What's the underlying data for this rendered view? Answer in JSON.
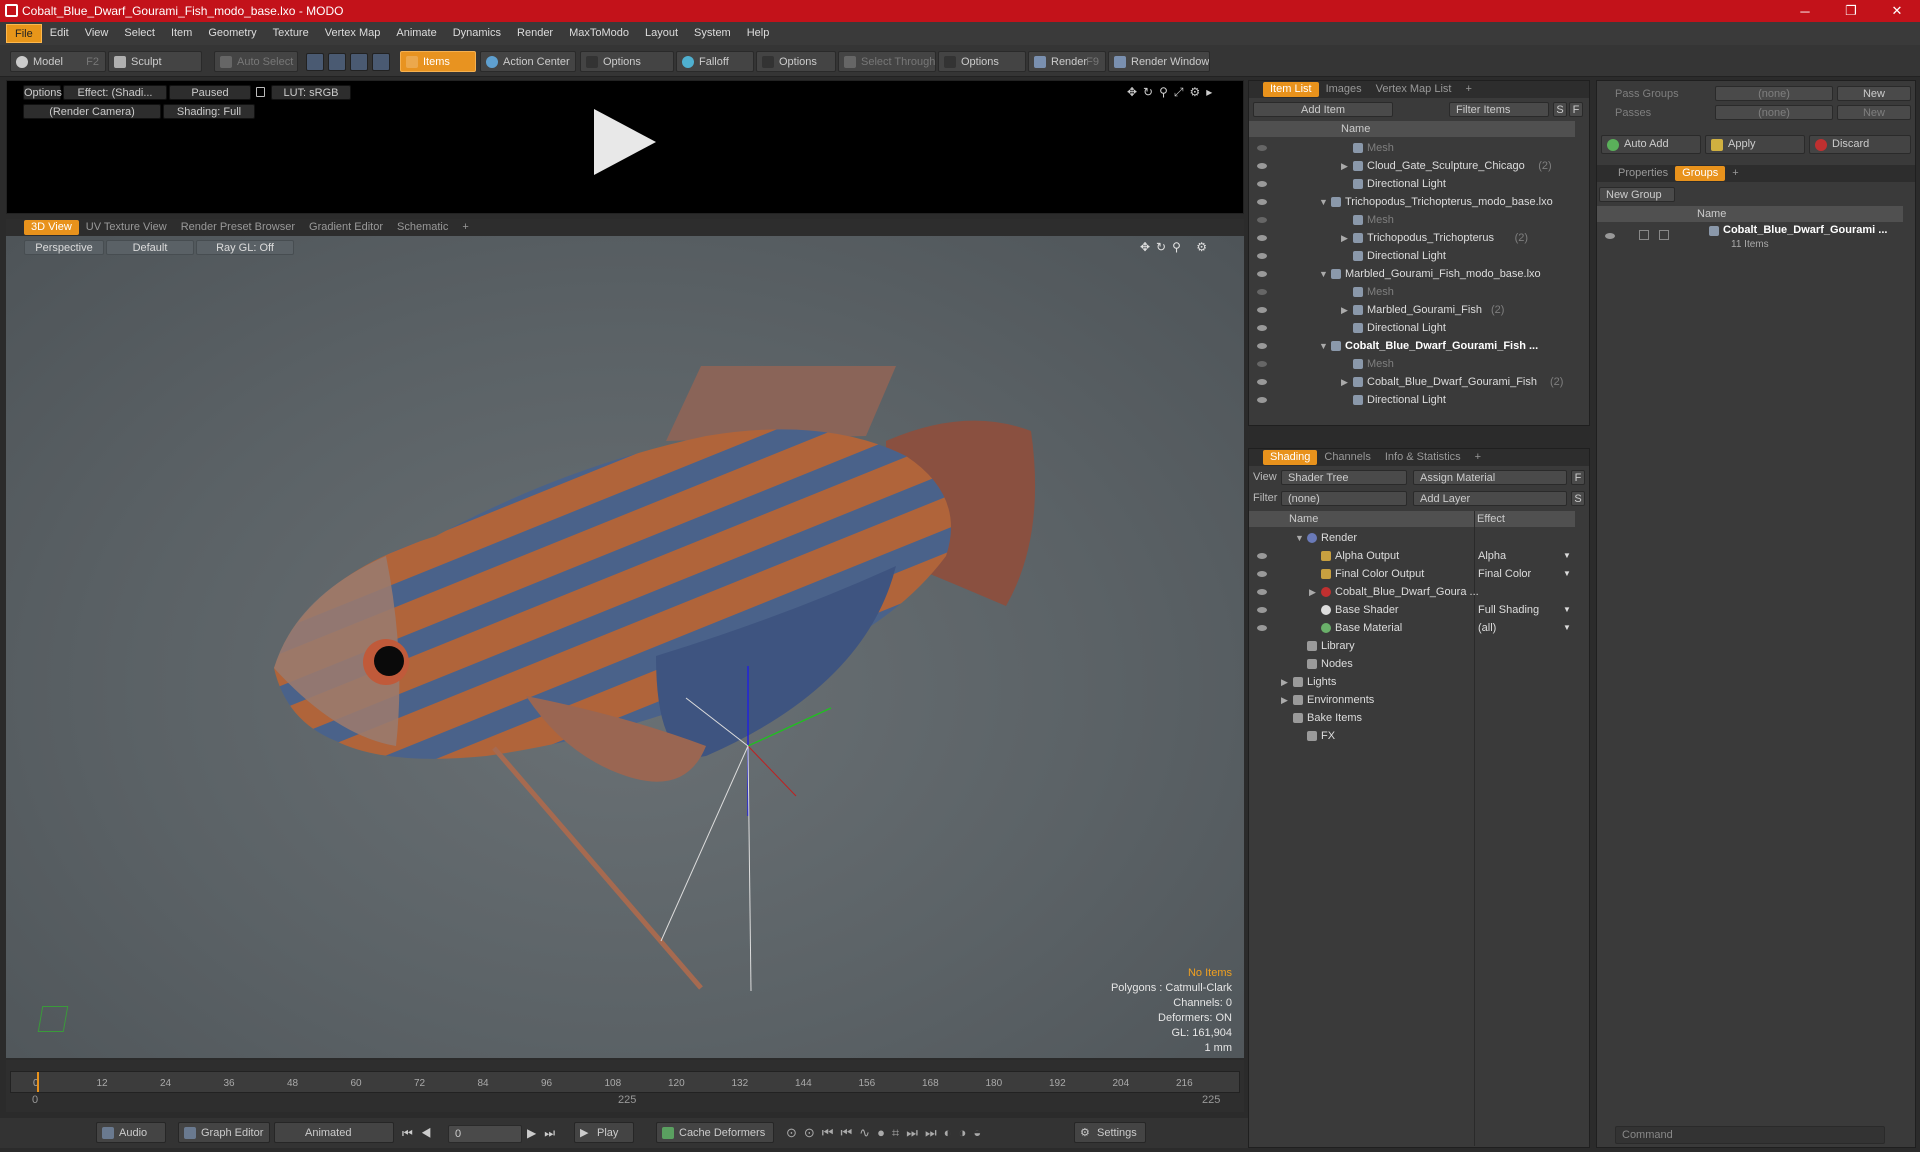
{
  "window": {
    "title": "Cobalt_Blue_Dwarf_Gourami_Fish_modo_base.lxo - MODO",
    "minimize": "─",
    "maximize": "❐",
    "close": "✕"
  },
  "menu": [
    "File",
    "Edit",
    "View",
    "Select",
    "Item",
    "Geometry",
    "Texture",
    "Vertex Map",
    "Animate",
    "Dynamics",
    "Render",
    "MaxToModo",
    "Layout",
    "System",
    "Help"
  ],
  "toolbar": {
    "model": "Model",
    "model_key": "F2",
    "sculpt": "Sculpt",
    "auto_select": "Auto Select",
    "items": "Items",
    "action_center": "Action Center",
    "options1": "Options",
    "falloff": "Falloff",
    "options2": "Options",
    "select_through": "Select Through",
    "options3": "Options",
    "render": "Render",
    "render_key": "F9",
    "render_window": "Render Window"
  },
  "preview": {
    "options": "Options",
    "effect": "Effect: (Shadi...",
    "paused": "Paused",
    "lut": "LUT: sRGB",
    "camera": "(Render Camera)",
    "shading": "Shading: Full"
  },
  "viewport_tabs": [
    "3D View",
    "UV Texture View",
    "Render Preset Browser",
    "Gradient Editor",
    "Schematic",
    "+"
  ],
  "viewport": {
    "perspective": "Perspective",
    "default": "Default",
    "raygl": "Ray GL: Off",
    "info": {
      "no_items": "No Items",
      "polygons": "Polygons : Catmull-Clark",
      "channels": "Channels: 0",
      "deformers": "Deformers: ON",
      "gl": "GL: 161,904",
      "unit": "1 mm"
    }
  },
  "timeline": {
    "ticks": [
      "0",
      "12",
      "24",
      "36",
      "48",
      "60",
      "72",
      "84",
      "96",
      "108",
      "120",
      "132",
      "144",
      "156",
      "168",
      "180",
      "192",
      "204",
      "216"
    ],
    "start": "0",
    "mid": "225",
    "end": "225"
  },
  "bottombar": {
    "audio": "Audio",
    "graph_editor": "Graph Editor",
    "animated": "Animated",
    "frame": "0",
    "play": "Play",
    "cache": "Cache Deformers",
    "settings": "Settings"
  },
  "item_list": {
    "tabs": [
      "Item List",
      "Images",
      "Vertex Map List",
      "+"
    ],
    "add_item": "Add Item",
    "filter_items": "Filter Items",
    "s": "S",
    "f": "F",
    "col_name": "Name",
    "rows": [
      {
        "label": "Mesh",
        "count": "",
        "indent": 2,
        "tri": "",
        "dim": true,
        "bold": false
      },
      {
        "label": "Cloud_Gate_Sculpture_Chicago",
        "count": "(2)",
        "indent": 2,
        "tri": "▶",
        "dim": false,
        "bold": false
      },
      {
        "label": "Directional Light",
        "count": "",
        "indent": 2,
        "tri": "",
        "dim": false,
        "bold": false
      },
      {
        "label": "Trichopodus_Trichopterus_modo_base.lxo",
        "count": "",
        "indent": 1,
        "tri": "▼",
        "dim": false,
        "bold": false
      },
      {
        "label": "Mesh",
        "count": "",
        "indent": 2,
        "tri": "",
        "dim": true,
        "bold": false
      },
      {
        "label": "Trichopodus_Trichopterus",
        "count": "(2)",
        "indent": 2,
        "tri": "▶",
        "dim": false,
        "bold": false
      },
      {
        "label": "Directional Light",
        "count": "",
        "indent": 2,
        "tri": "",
        "dim": false,
        "bold": false
      },
      {
        "label": "Marbled_Gourami_Fish_modo_base.lxo",
        "count": "",
        "indent": 1,
        "tri": "▼",
        "dim": false,
        "bold": false
      },
      {
        "label": "Mesh",
        "count": "",
        "indent": 2,
        "tri": "",
        "dim": true,
        "bold": false
      },
      {
        "label": "Marbled_Gourami_Fish",
        "count": "(2)",
        "indent": 2,
        "tri": "▶",
        "dim": false,
        "bold": false
      },
      {
        "label": "Directional Light",
        "count": "",
        "indent": 2,
        "tri": "",
        "dim": false,
        "bold": false
      },
      {
        "label": "Cobalt_Blue_Dwarf_Gourami_Fish ...",
        "count": "",
        "indent": 1,
        "tri": "▼",
        "dim": false,
        "bold": true
      },
      {
        "label": "Mesh",
        "count": "",
        "indent": 2,
        "tri": "",
        "dim": true,
        "bold": false
      },
      {
        "label": "Cobalt_Blue_Dwarf_Gourami_Fish",
        "count": "(2)",
        "indent": 2,
        "tri": "▶",
        "dim": false,
        "bold": false
      },
      {
        "label": "Directional Light",
        "count": "",
        "indent": 2,
        "tri": "",
        "dim": false,
        "bold": false
      }
    ]
  },
  "shading": {
    "tabs": [
      "Shading",
      "Channels",
      "Info & Statistics",
      "+"
    ],
    "view_label": "View",
    "view_value": "Shader Tree",
    "assign_material": "Assign Material",
    "f": "F",
    "filter_label": "Filter",
    "filter_value": "(none)",
    "add_layer": "Add Layer",
    "s": "S",
    "col_name": "Name",
    "col_effect": "Effect",
    "rows": [
      {
        "label": "Render",
        "effect": "",
        "indent": 1,
        "tri": "▼",
        "eye": false
      },
      {
        "label": "Alpha Output",
        "effect": "Alpha",
        "indent": 2,
        "tri": "",
        "eye": true
      },
      {
        "label": "Final Color Output",
        "effect": "Final Color",
        "indent": 2,
        "tri": "",
        "eye": true
      },
      {
        "label": "Cobalt_Blue_Dwarf_Goura ...",
        "effect": "",
        "indent": 2,
        "tri": "▶",
        "eye": true
      },
      {
        "label": "Base Shader",
        "effect": "Full Shading",
        "indent": 2,
        "tri": "",
        "eye": true
      },
      {
        "label": "Base Material",
        "effect": "(all)",
        "indent": 2,
        "tri": "",
        "eye": true
      },
      {
        "label": "Library",
        "effect": "",
        "indent": 1,
        "tri": "",
        "eye": false
      },
      {
        "label": "Nodes",
        "effect": "",
        "indent": 1,
        "tri": "",
        "eye": false
      },
      {
        "label": "Lights",
        "effect": "",
        "indent": 0,
        "tri": "▶",
        "eye": false
      },
      {
        "label": "Environments",
        "effect": "",
        "indent": 0,
        "tri": "▶",
        "eye": false
      },
      {
        "label": "Bake Items",
        "effect": "",
        "indent": 0,
        "tri": "",
        "eye": false
      },
      {
        "label": "FX",
        "effect": "",
        "indent": 1,
        "tri": "",
        "eye": false
      }
    ]
  },
  "groups": {
    "pass_groups_label": "Pass Groups",
    "pass_groups_value": "(none)",
    "new1": "New",
    "passes_label": "Passes",
    "passes_value": "(none)",
    "new2": "New",
    "auto_add": "Auto Add",
    "apply": "Apply",
    "discard": "Discard",
    "tabs": [
      "Properties",
      "Groups",
      "+"
    ],
    "new_group": "New Group",
    "col_name": "Name",
    "item_name": "Cobalt_Blue_Dwarf_Gourami ...",
    "item_count": "11 Items",
    "command_placeholder": "Command"
  }
}
